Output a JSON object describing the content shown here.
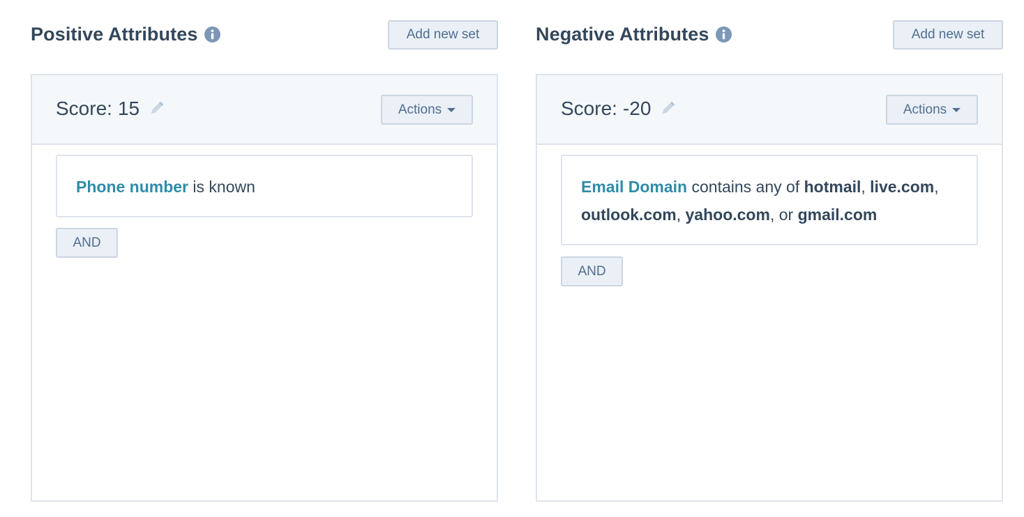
{
  "positive": {
    "title": "Positive Attributes",
    "add_set_label": "Add new set",
    "set": {
      "score_label": "Score:",
      "score_value": "15",
      "actions_label": "Actions",
      "criteria": {
        "property": "Phone number",
        "operator": "is known"
      },
      "and_label": "AND"
    }
  },
  "negative": {
    "title": "Negative Attributes",
    "add_set_label": "Add new set",
    "set": {
      "score_label": "Score:",
      "score_value": "-20",
      "actions_label": "Actions",
      "criteria": {
        "property": "Email Domain",
        "operator": "contains any of",
        "values": [
          "hotmail",
          "live.com",
          "outlook.com",
          "yahoo.com",
          "gmail.com"
        ],
        "sep_1": ",",
        "sep_2": ",",
        "sep_3": ",",
        "sep_4": ", or"
      },
      "and_label": "AND"
    }
  },
  "colors": {
    "text": "#33475b",
    "link": "#2f8ca8",
    "button_bg": "#eaf0f6",
    "button_border": "#cbd6e2",
    "panel_header_bg": "#f5f8fa",
    "panel_border": "#dfe3eb",
    "icon_grey": "#7c98b6"
  },
  "icons": {
    "info": "info-circle-icon",
    "edit": "pencil-icon",
    "dropdown": "caret-down-icon"
  }
}
